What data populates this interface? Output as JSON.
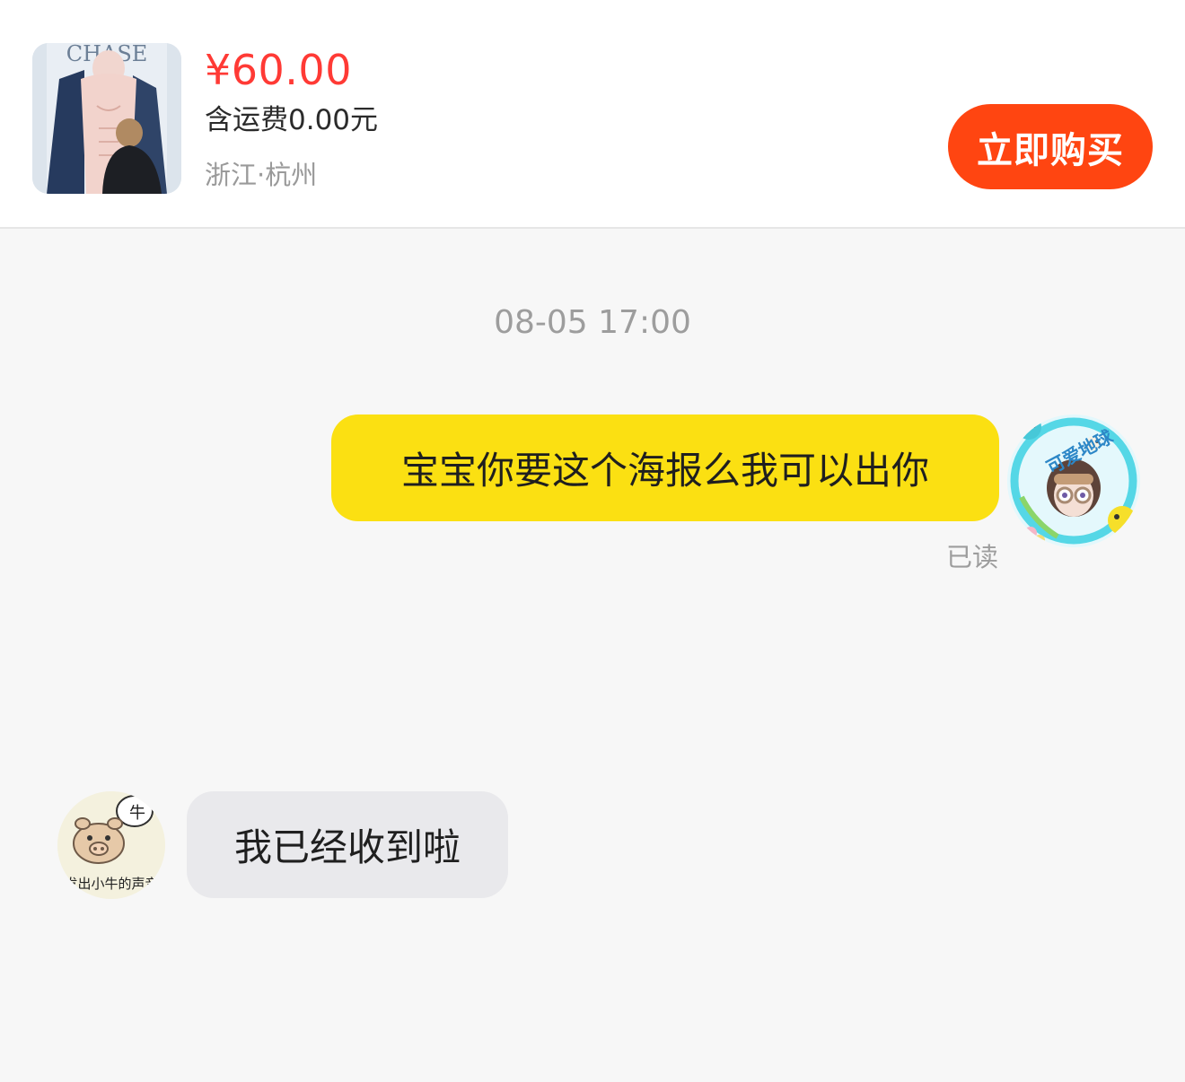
{
  "product": {
    "image_icon": "poster-thumbnail",
    "price": "¥60.00",
    "shipping": "含运费0.00元",
    "location": "浙江·杭州",
    "buy_label": "立即购买"
  },
  "chat": {
    "timestamp": "08-05 17:00",
    "messages": [
      {
        "side": "right",
        "text": "宝宝你要这个海报么我可以出你",
        "status": "已读",
        "avatar_icon": "anime-avatar-icon",
        "avatar_text": "可爱地球"
      },
      {
        "side": "left",
        "text": "我已经收到啦",
        "avatar_icon": "cartoon-pig-avatar-icon",
        "avatar_text": "发出小牛的声音",
        "avatar_badge": "牛"
      }
    ]
  },
  "colors": {
    "price": "#ff3a35",
    "buy_button": "#ff4511",
    "outgoing_bubble": "#fbe012",
    "incoming_bubble": "#e9e9ec"
  }
}
